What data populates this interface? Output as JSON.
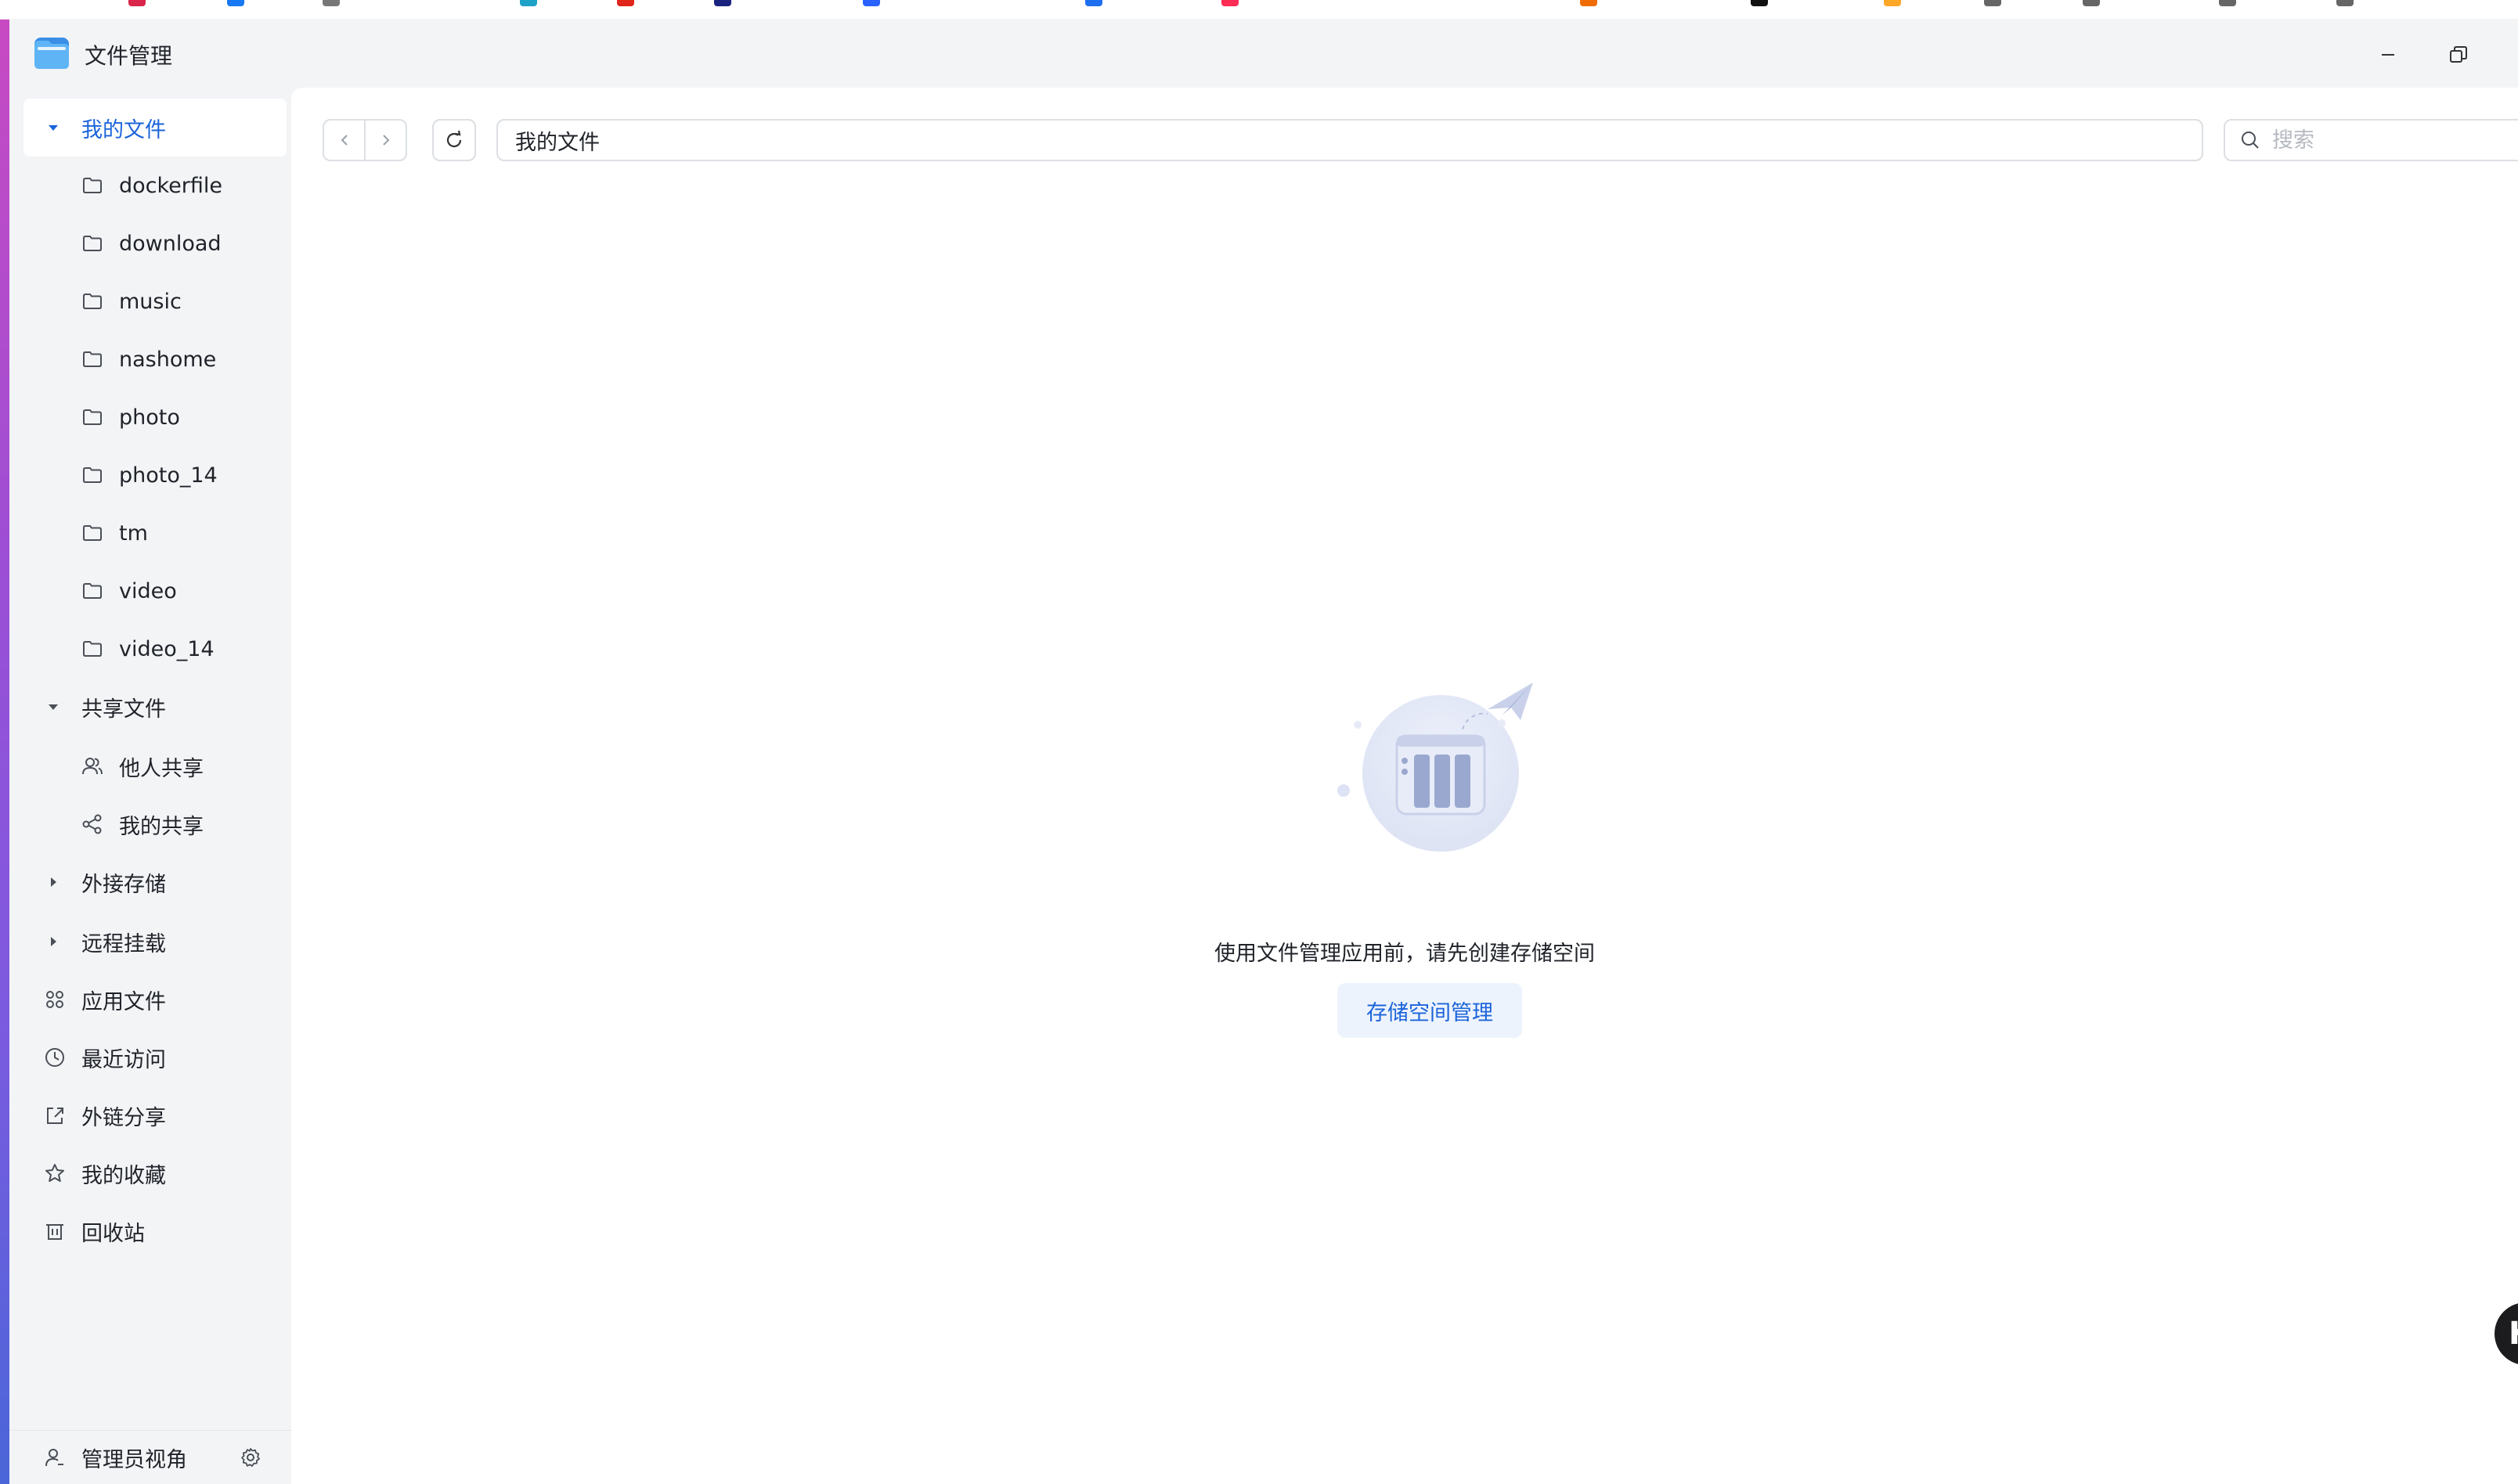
{
  "window": {
    "title": "文件管理",
    "minimize_label": "minimize",
    "restore_label": "restore"
  },
  "sidebar": {
    "my_files": {
      "label": "我的文件",
      "folders": [
        "dockerfile",
        "download",
        "music",
        "nashome",
        "photo",
        "photo_14",
        "tm",
        "video",
        "video_14"
      ]
    },
    "shared": {
      "label": "共享文件",
      "items": [
        "他人共享",
        "我的共享"
      ]
    },
    "external_storage": "外接存储",
    "remote_mount": "远程挂载",
    "app_files": "应用文件",
    "recent": "最近访问",
    "link_share": "外链分享",
    "favorites": "我的收藏",
    "recycle_bin": "回收站",
    "footer": {
      "admin_view": "管理员视角"
    }
  },
  "toolbar": {
    "path": "我的文件",
    "search_placeholder": "搜索"
  },
  "empty_state": {
    "message": "使用文件管理应用前，请先创建存储空间",
    "button_label": "存储空间管理"
  },
  "floating_badge": {
    "letter": "K"
  },
  "colors": {
    "accent": "#1b64da",
    "sidebar_bg": "#f3f4f6",
    "active_bg": "#ffffff"
  }
}
